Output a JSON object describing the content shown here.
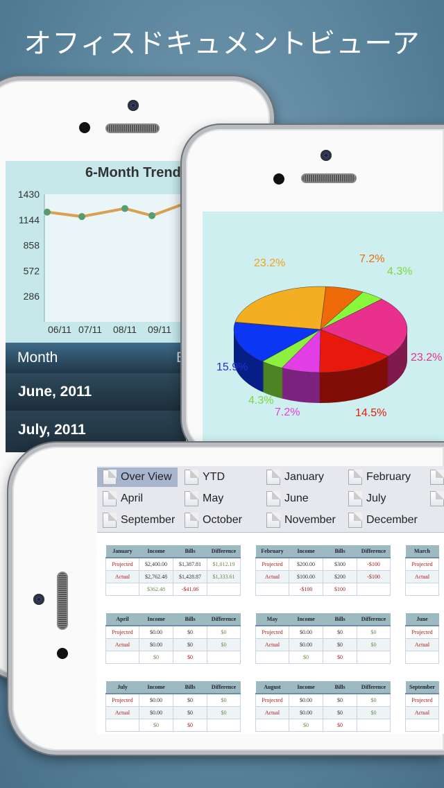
{
  "title": "オフィスドキュメントビューア",
  "trend": {
    "title": "6-Month Trend",
    "columns": [
      "Month",
      "B"
    ],
    "rows": [
      "June, 2011",
      "July, 2011"
    ]
  },
  "chart_data": [
    {
      "type": "line",
      "title": "6-Month Trend",
      "categories": [
        "06/11",
        "07/11",
        "08/11",
        "09/11"
      ],
      "values": [
        1230,
        1180,
        1270,
        1190
      ],
      "yticks": [
        286,
        572,
        858,
        1144,
        1430
      ],
      "ylim": [
        0,
        1430
      ],
      "line_color": "#d9a050",
      "marker_color": "#5a9a70"
    },
    {
      "type": "pie",
      "labels": [
        "23.2%",
        "7.2%",
        "4.3%",
        "23.2%",
        "14.5%",
        "7.2%",
        "4.3%",
        "15.9%"
      ],
      "values": [
        23.2,
        7.2,
        4.3,
        23.2,
        14.5,
        7.2,
        4.3,
        15.9
      ],
      "colors": [
        "#f4ae22",
        "#ee6a08",
        "#88f83c",
        "#e8308c",
        "#e8180c",
        "#e23ee6",
        "#8cf040",
        "#0a36f4"
      ]
    }
  ],
  "tabs": [
    "Over View",
    "YTD",
    "January",
    "February",
    "",
    "April",
    "May",
    "June",
    "July",
    "",
    "September",
    "October",
    "November",
    "December"
  ],
  "selected_tab": "Over View",
  "tables": [
    {
      "month": "January",
      "income": [
        "$2,400.00",
        "$2,762.48",
        "$362.48"
      ],
      "bills": [
        "$1,387.81",
        "$1,428.87",
        "-$41.06"
      ],
      "diff": [
        "$1,012.19",
        "$1,333.61"
      ]
    },
    {
      "month": "February",
      "income": [
        "$200.00",
        "$100.00",
        "-$100"
      ],
      "bills": [
        "$300",
        "$200",
        "$100"
      ],
      "diff": [
        "-$100",
        "-$100"
      ]
    },
    {
      "month": "March"
    },
    {
      "month": "April",
      "income": [
        "$0.00",
        "$0.00",
        "$0"
      ],
      "bills": [
        "$0",
        "$0",
        "$0"
      ],
      "diff": [
        "$0",
        "$0"
      ]
    },
    {
      "month": "May",
      "income": [
        "$0.00",
        "$0.00",
        "$0"
      ],
      "bills": [
        "$0",
        "$0",
        "$0"
      ],
      "diff": [
        "$0",
        "$0"
      ]
    },
    {
      "month": "June"
    },
    {
      "month": "July",
      "income": [
        "$0.00",
        "$0.00",
        "$0"
      ],
      "bills": [
        "$0",
        "$0",
        "$0"
      ],
      "diff": [
        "$0",
        "$0"
      ]
    },
    {
      "month": "August",
      "income": [
        "$0.00",
        "$0.00",
        "$0"
      ],
      "bills": [
        "$0",
        "$0",
        "$0"
      ],
      "diff": [
        "$0",
        "$0"
      ]
    },
    {
      "month": "September"
    }
  ],
  "table_headers": {
    "income": "Income",
    "bills": "Bills",
    "difference": "Difference",
    "projected": "Projected",
    "actual": "Actual"
  }
}
